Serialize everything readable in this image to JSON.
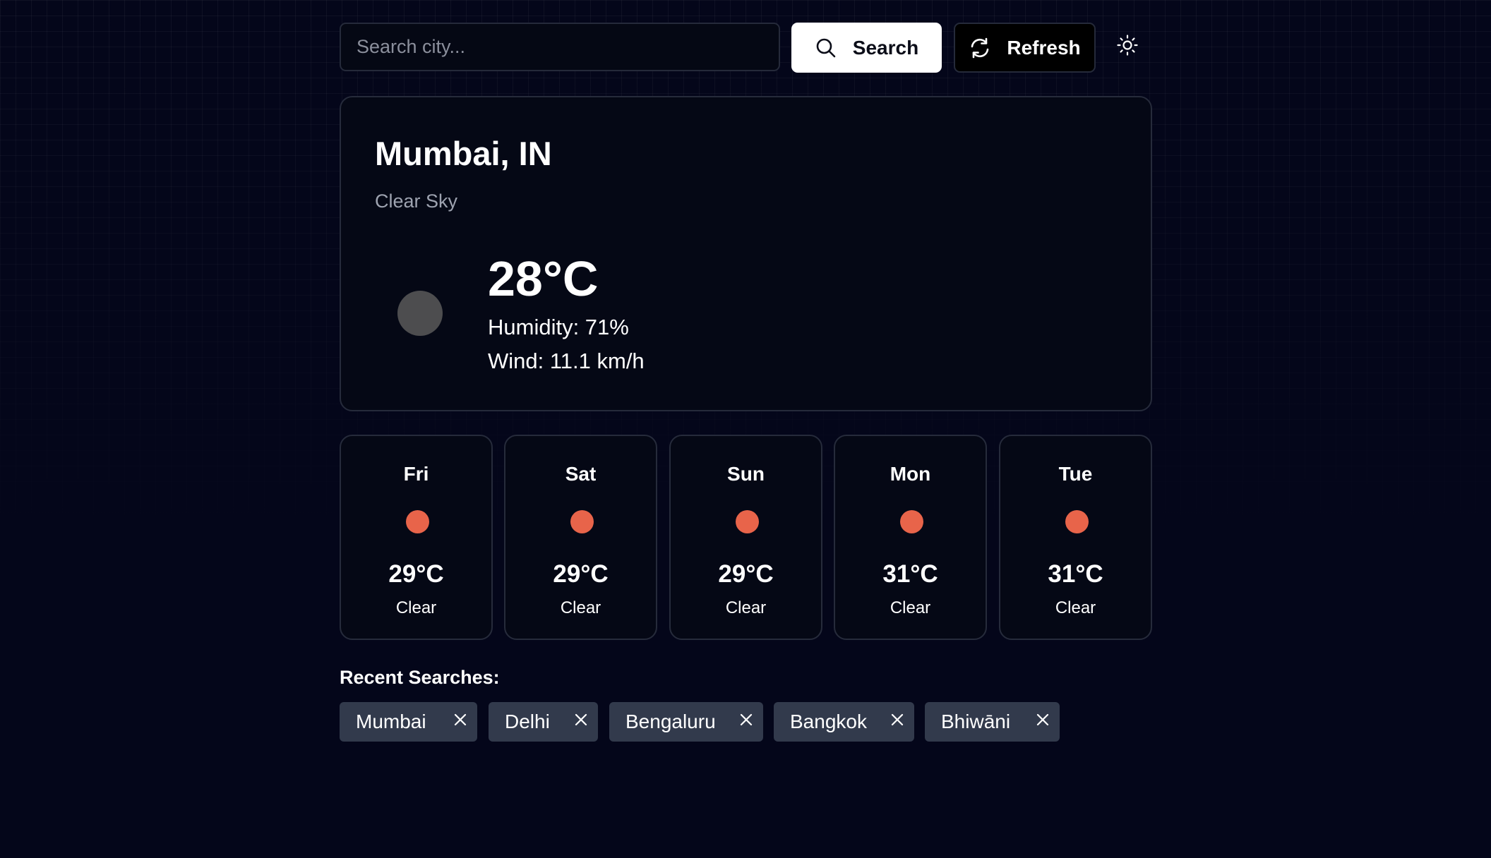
{
  "search": {
    "placeholder": "Search city...",
    "value": "",
    "button_label": "Search",
    "button_icon": "search-icon"
  },
  "refresh": {
    "label": "Refresh",
    "icon": "refresh-icon"
  },
  "theme_toggle": {
    "icon": "sun-icon"
  },
  "current": {
    "city": "Mumbai, IN",
    "condition": "Clear Sky",
    "temperature": "28°C",
    "humidity": "Humidity: 71%",
    "wind": "Wind: 11.1 km/h",
    "icon_color": "#4d4d4f"
  },
  "forecast": [
    {
      "day": "Fri",
      "temp": "29°C",
      "desc": "Clear",
      "icon_color": "#e8644a"
    },
    {
      "day": "Sat",
      "temp": "29°C",
      "desc": "Clear",
      "icon_color": "#e8644a"
    },
    {
      "day": "Sun",
      "temp": "29°C",
      "desc": "Clear",
      "icon_color": "#e8644a"
    },
    {
      "day": "Mon",
      "temp": "31°C",
      "desc": "Clear",
      "icon_color": "#e8644a"
    },
    {
      "day": "Tue",
      "temp": "31°C",
      "desc": "Clear",
      "icon_color": "#e8644a"
    }
  ],
  "recent": {
    "title": "Recent Searches:",
    "items": [
      {
        "label": "Mumbai"
      },
      {
        "label": "Delhi"
      },
      {
        "label": "Bengaluru"
      },
      {
        "label": "Bangkok"
      },
      {
        "label": "Bhiwāni"
      }
    ]
  },
  "colors": {
    "background": "#04061a",
    "card_border": "#262b3b",
    "chip_bg": "#323a4c",
    "forecast_icon": "#e8644a"
  }
}
